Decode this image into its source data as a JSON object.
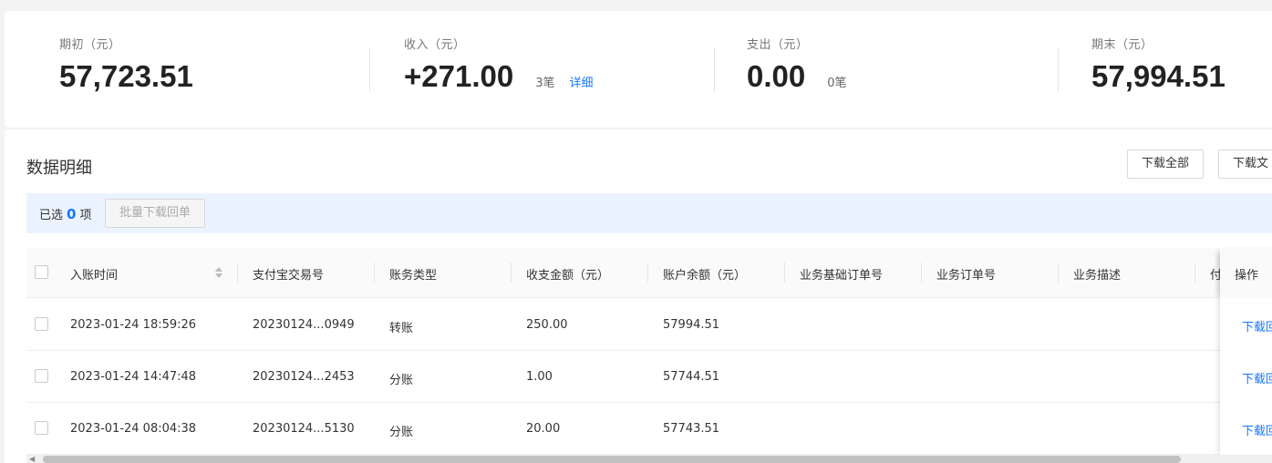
{
  "summary": {
    "opening": {
      "label": "期初（元）",
      "value": "57,723.51"
    },
    "income": {
      "label": "收入（元）",
      "value": "+271.00",
      "count": "3笔",
      "link": "详细"
    },
    "expense": {
      "label": "支出（元）",
      "value": "0.00",
      "count": "0笔"
    },
    "closing": {
      "label": "期末（元）",
      "value": "57,994.51"
    }
  },
  "section": {
    "title": "数据明细",
    "download_all": "下载全部",
    "download_file": "下载文"
  },
  "selection": {
    "prefix": "已选",
    "count": "0",
    "suffix": "项",
    "batch_button": "批量下载回单"
  },
  "table": {
    "headers": {
      "time": "入账时间",
      "trade_no": "支付宝交易号",
      "type": "账务类型",
      "amount": "收支金额（元）",
      "balance": "账户余额（元）",
      "base_order": "业务基础订单号",
      "order": "业务订单号",
      "desc": "业务描述",
      "pay": "付",
      "op": "操作"
    },
    "rows": [
      {
        "time": "2023-01-24 18:59:26",
        "trade_no": "20230124...0949",
        "type": "转账",
        "amount": "250.00",
        "balance": "57994.51",
        "action": "下载回"
      },
      {
        "time": "2023-01-24 14:47:48",
        "trade_no": "20230124...2453",
        "type": "分账",
        "amount": "1.00",
        "balance": "57744.51",
        "action": "下载回"
      },
      {
        "time": "2023-01-24 08:04:38",
        "trade_no": "20230124...5130",
        "type": "分账",
        "amount": "20.00",
        "balance": "57743.51",
        "action": "下载回"
      }
    ]
  },
  "colors": {
    "accent": "#1677ff",
    "selection_bg": "#eaf3ff"
  }
}
